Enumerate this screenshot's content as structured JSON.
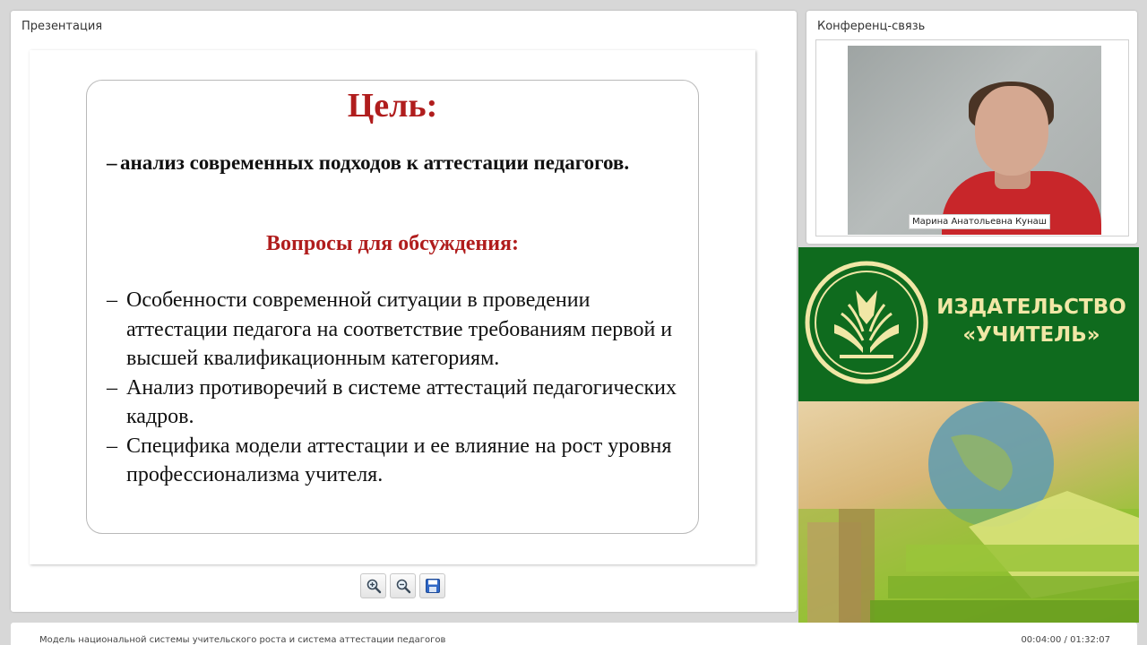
{
  "presentation": {
    "title": "Презентация",
    "slide": {
      "heading": "Цель:",
      "goal_dash": "–",
      "goal_text": "анализ современных подходов к аттестации педагогов.",
      "questions_heading": "Вопросы для обсуждения:",
      "item_dash": "–",
      "questions": [
        "Особенности современной ситуации в проведении аттестации педагога на соответствие требованиям первой и высшей квалификационным категориям.",
        "Анализ противоречий в системе аттестаций педагогических кадров.",
        "Специфика модели аттестации и ее влияние на рост уровня профессионализма учителя."
      ]
    },
    "toolbar": {
      "zoom_in_icon": "zoom-in-icon",
      "zoom_out_icon": "zoom-out-icon",
      "save_icon": "save-icon"
    }
  },
  "conference": {
    "title": "Конференц-связь",
    "participant_name": "Марина Анатольевна Кунаш"
  },
  "brand": {
    "line1": "ИЗДАТЕЛЬСТВО",
    "line2": "«УЧИТЕЛЬ»",
    "colors": {
      "green": "#0f6b1e",
      "text": "#f1e7a6"
    }
  },
  "footer": {
    "lecture_title": "Модель национальной системы учительского роста и система аттестации педагогов",
    "time": "00:04:00 / 01:32:07"
  },
  "colors": {
    "heading_red": "#b01d1d",
    "background": "#d7d7d7"
  }
}
